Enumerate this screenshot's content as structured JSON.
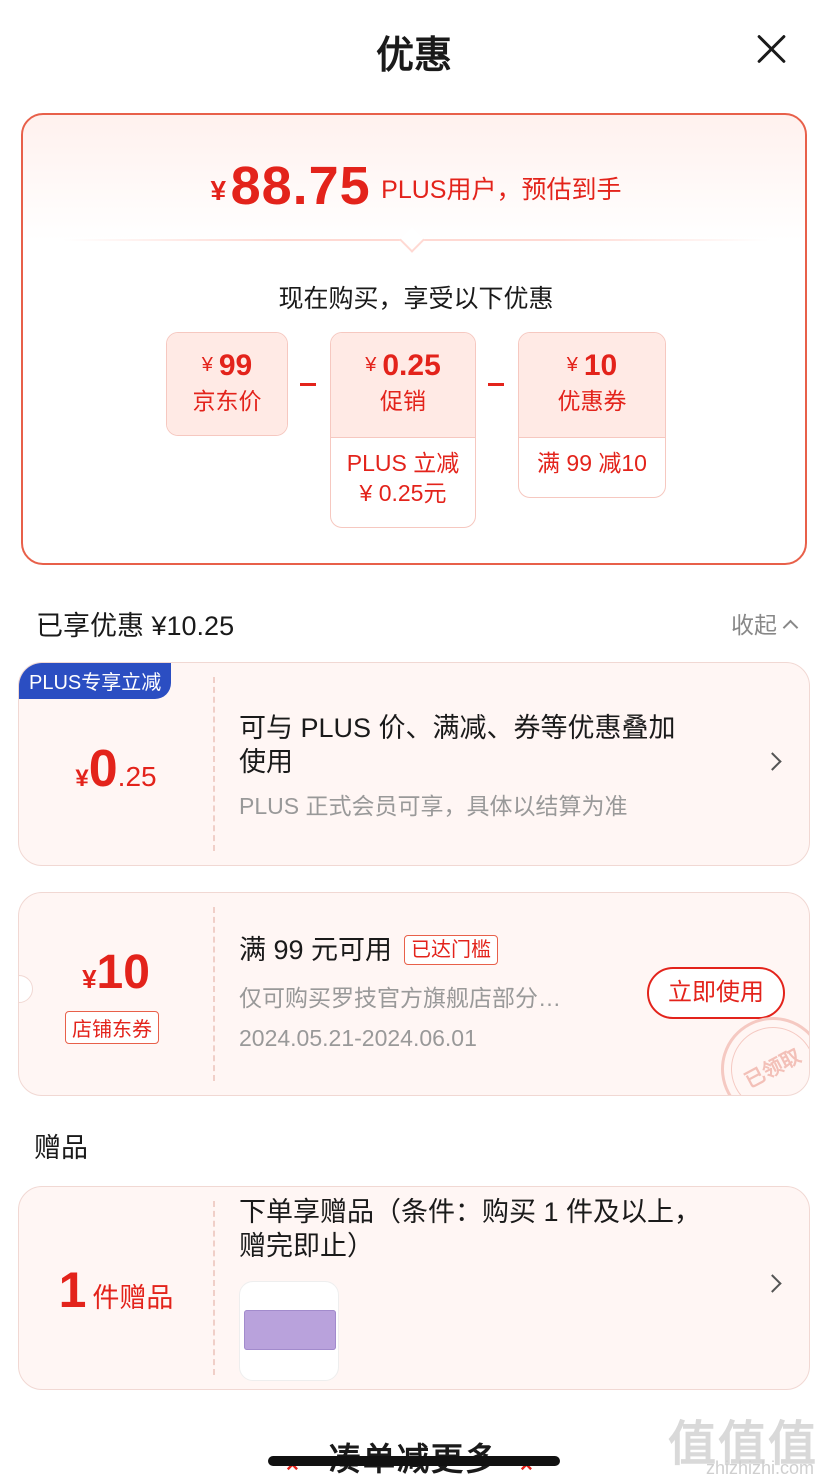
{
  "header": {
    "title": "优惠"
  },
  "summary": {
    "currency": "¥",
    "final_price": "88.75",
    "final_desc": "PLUS用户，预估到手",
    "intro": "现在购买，享受以下优惠",
    "items": [
      {
        "currency": "¥",
        "value": "99",
        "label": "京东价",
        "sub": ""
      },
      {
        "currency": "¥",
        "value": "0.25",
        "label": "促销",
        "sub_line1": "PLUS 立减",
        "sub_line2": "¥ 0.25元"
      },
      {
        "currency": "¥",
        "value": "10",
        "label": "优惠券",
        "sub_line1": "满 99 减10"
      }
    ]
  },
  "discounts": {
    "title": "已享优惠 ¥10.25",
    "collapse_label": "收起",
    "plus_card": {
      "badge": "PLUS专享立减",
      "currency": "¥",
      "amount_int": "0",
      "amount_dec": ".25",
      "title_line1": "可与 PLUS 价、满减、券等优惠叠加",
      "title_line2": "使用",
      "note": "PLUS 正式会员可享，具体以结算为准"
    },
    "coupon_card": {
      "currency": "¥",
      "amount": "10",
      "store_tag": "店铺东券",
      "title": "满 99 元可用",
      "reached_tag": "已达门槛",
      "desc": "仅可购买罗技官方旗舰店部分…",
      "validity": "2024.05.21-2024.06.01",
      "use_button": "立即使用",
      "stamp": "已领取"
    }
  },
  "gifts": {
    "title": "赠品",
    "count": "1",
    "unit": "件赠品",
    "desc_line1": "下单享赠品（条件：购买 1 件及以上，",
    "desc_line2": "赠完即止）"
  },
  "footer": {
    "more_label": "凑单减更多",
    "watermark": "值值值",
    "watermark_sub": "zhizhizhi.com"
  },
  "colors": {
    "accent_red": "#e3231b",
    "plus_blue": "#2b4ec2",
    "card_bg": "#fff6f4",
    "gift_thumb": "#b9a2dc"
  }
}
